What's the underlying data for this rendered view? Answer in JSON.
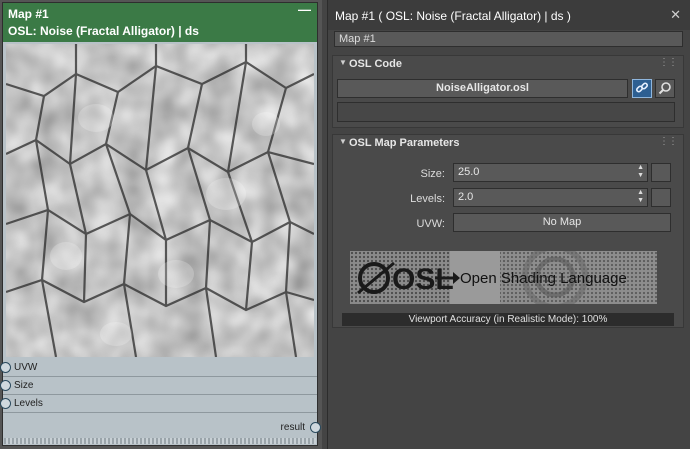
{
  "node": {
    "title": "Map #1",
    "subtitle": "OSL: Noise (Fractal Alligator) | ds",
    "collapse_glyph": "—",
    "ports": [
      "UVW",
      "Size",
      "Levels"
    ],
    "output": "result"
  },
  "panel": {
    "title": "Map #1  ( OSL: Noise (Fractal Alligator) | ds )",
    "close_glyph": "✕",
    "map_name": "Map #1",
    "osl_code": {
      "title": "OSL Code",
      "file": "NoiseAlligator.osl",
      "link_icon": "link-icon",
      "browse_icon": "magnifier-icon",
      "field": ""
    },
    "params": {
      "title": "OSL Map Parameters",
      "size_label": "Size:",
      "size_value": "25.0",
      "levels_label": "Levels:",
      "levels_value": "2.0",
      "uvw_label": "UVW:",
      "uvw_button": "No Map",
      "logo_text": "Open Shading Language",
      "logo_letters": "OSL",
      "accuracy": "Viewport Accuracy (in Realistic Mode): 100%"
    },
    "arrow_glyph": "▼",
    "grip_glyph": "⋮⋮",
    "spinner_glyph_up": "▲",
    "spinner_glyph_down": "▼"
  },
  "colors": {
    "node_header": "#3b7a46",
    "node_body": "#b8c2c8",
    "panel_bg": "#444444",
    "accent_link": "#2d5f92"
  }
}
